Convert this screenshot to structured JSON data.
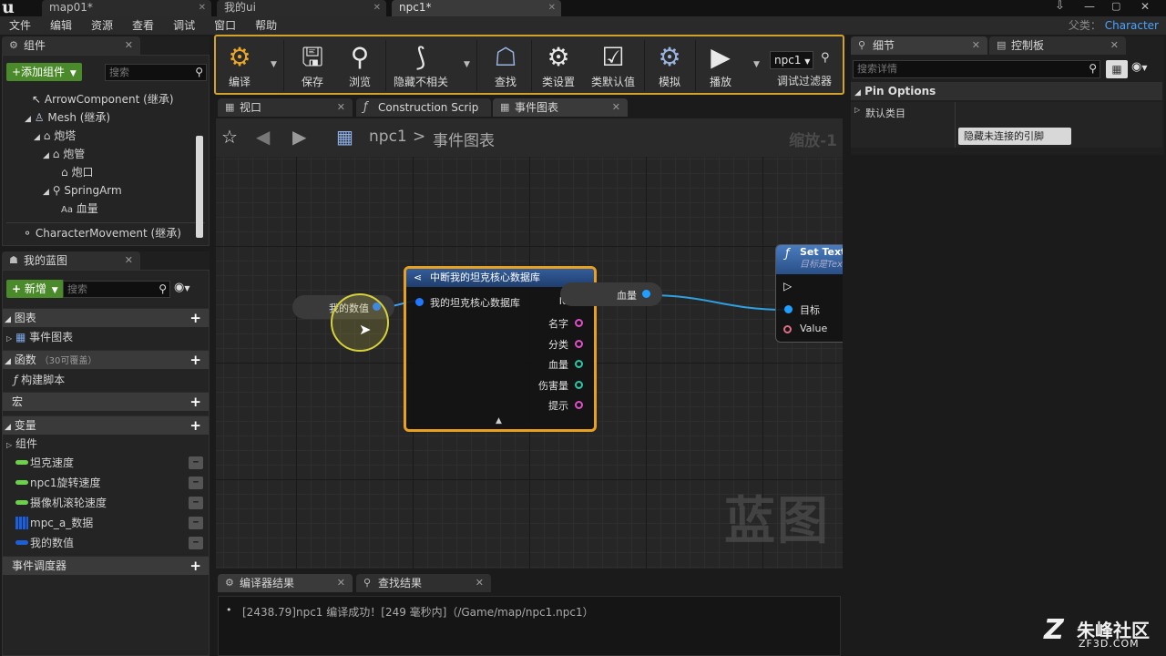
{
  "titlebar": {
    "tabs": [
      {
        "label": "map01*"
      },
      {
        "label": "我的ui"
      },
      {
        "label": "npc1*"
      }
    ]
  },
  "menubar": {
    "items": [
      "文件",
      "编辑",
      "资源",
      "查看",
      "调试",
      "窗口",
      "帮助"
    ],
    "parent_label": "父类：",
    "parent_value": "Character"
  },
  "components": {
    "tab_title": "组件",
    "add_button": "+添加组件",
    "search_placeholder": "搜索",
    "items": [
      {
        "label": "ArrowComponent (继承)",
        "icon": "arrow-icon"
      },
      {
        "label": "Mesh (继承)",
        "icon": "person-icon"
      },
      {
        "label": "炮塔",
        "icon": "cube-icon"
      },
      {
        "label": "炮管",
        "icon": "cube-icon"
      },
      {
        "label": "炮口",
        "icon": "cube-icon"
      },
      {
        "label": "SpringArm",
        "icon": "springarm-icon"
      },
      {
        "label": "血量",
        "icon": "text-icon"
      },
      {
        "label": "CharacterMovement (继承)",
        "icon": "movement-icon"
      }
    ]
  },
  "myblueprint": {
    "tab_title": "我的蓝图",
    "new_button": "新增",
    "search_placeholder": "搜索",
    "graphs_label": "图表",
    "event_graph": "事件图表",
    "functions_label": "函数",
    "functions_override": "（30可覆盖）",
    "construct_script": "构建脚本",
    "macros_label": "宏",
    "variables_label": "变量",
    "components_group": "组件",
    "variables": [
      {
        "label": "坦克速度",
        "color": "#6cd04a"
      },
      {
        "label": "npc1旋转速度",
        "color": "#6cd04a"
      },
      {
        "label": "摄像机滚轮速度",
        "color": "#6cd04a"
      },
      {
        "label": "mpc_a_数据",
        "color": "#1f5fd6"
      },
      {
        "label": "我的数值",
        "color": "#1f5fd6"
      }
    ],
    "dispatchers_label": "事件调度器"
  },
  "toolbar": {
    "buttons": [
      {
        "label": "编译",
        "icon": "compile-icon"
      },
      {
        "label": "保存",
        "icon": "save-icon"
      },
      {
        "label": "浏览",
        "icon": "browse-icon"
      },
      {
        "label": "隐藏不相关",
        "icon": "hide-unrelated-icon"
      },
      {
        "label": "查找",
        "icon": "find-icon"
      },
      {
        "label": "类设置",
        "icon": "class-settings-icon"
      },
      {
        "label": "类默认值",
        "icon": "class-defaults-icon"
      },
      {
        "label": "模拟",
        "icon": "simulate-icon"
      },
      {
        "label": "播放",
        "icon": "play-icon"
      }
    ],
    "debug_select": "npc1",
    "debug_filter_label": "调试过滤器"
  },
  "editor_tabs": [
    {
      "label": "视口"
    },
    {
      "label": "Construction Scrip"
    },
    {
      "label": "事件图表"
    }
  ],
  "breadcrumb": {
    "root": "npc1",
    "separator": ">",
    "leaf": "事件图表",
    "zoom": "缩放-1"
  },
  "graph": {
    "watermark": "蓝图",
    "var_node": {
      "label": "我的数值"
    },
    "break_node": {
      "title": "中断我的坦克核心数据库",
      "input_label": "我的坦克核心数据库",
      "outputs": [
        {
          "label": "Id",
          "color": "#27c8a8"
        },
        {
          "label": "名字",
          "color": "#e04ec8"
        },
        {
          "label": "分类",
          "color": "#e04ec8"
        },
        {
          "label": "血量",
          "color": "#27c8a8"
        },
        {
          "label": "伤害量",
          "color": "#27c8a8"
        },
        {
          "label": "提示",
          "color": "#e04ec8"
        }
      ]
    },
    "get_node": {
      "label": "血量"
    },
    "settext_node": {
      "title": "Set Text",
      "subtitle": "目标是Tex",
      "target_label": "目标",
      "value_label": "Value"
    }
  },
  "details": {
    "tab_title": "细节",
    "tab2_title": "控制板",
    "search_placeholder": "搜索详情",
    "section": "Pin Options",
    "category": "默认类目",
    "hide_button": "隐藏未连接的引脚"
  },
  "bottom": {
    "tab1": "编译器结果",
    "tab2": "查找结果",
    "log_line": "[2438.79]npc1 编译成功！[249 毫秒内]（/Game/map/npc1.npc1）"
  },
  "branding": {
    "name": "朱峰社区",
    "site": "ZF3D.COM"
  }
}
